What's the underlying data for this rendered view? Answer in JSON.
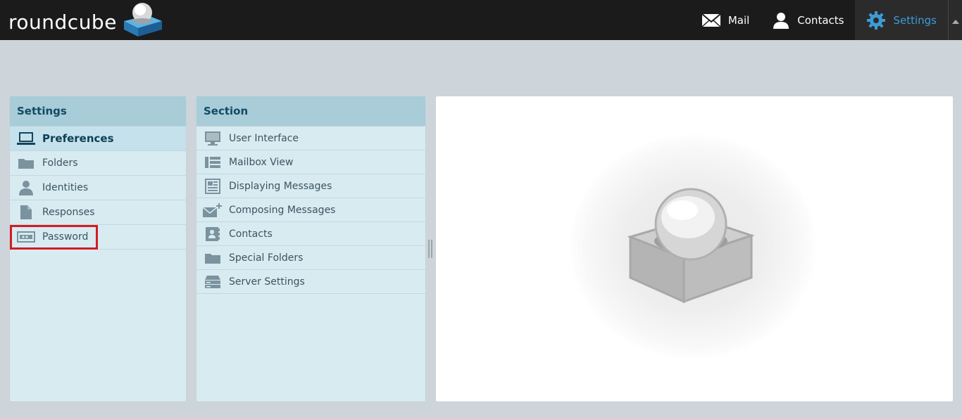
{
  "app": {
    "logo_text": "roundcube"
  },
  "topnav": [
    {
      "label": "Mail",
      "icon": "mail-icon"
    },
    {
      "label": "Contacts",
      "icon": "contacts-icon"
    },
    {
      "label": "Settings",
      "icon": "gear-icon",
      "active": true
    }
  ],
  "settings_panel": {
    "title": "Settings",
    "items": [
      {
        "label": "Preferences",
        "icon": "laptop-icon",
        "selected": true
      },
      {
        "label": "Folders",
        "icon": "folder-icon"
      },
      {
        "label": "Identities",
        "icon": "identity-icon"
      },
      {
        "label": "Responses",
        "icon": "document-icon"
      },
      {
        "label": "Password",
        "icon": "password-icon"
      }
    ]
  },
  "section_panel": {
    "title": "Section",
    "items": [
      {
        "label": "User Interface",
        "icon": "monitor-icon"
      },
      {
        "label": "Mailbox View",
        "icon": "list-view-icon"
      },
      {
        "label": "Displaying Messages",
        "icon": "message-view-icon"
      },
      {
        "label": "Composing Messages",
        "icon": "compose-mail-icon"
      },
      {
        "label": "Contacts",
        "icon": "address-book-icon"
      },
      {
        "label": "Special Folders",
        "icon": "folder-icon"
      },
      {
        "label": "Server Settings",
        "icon": "server-icon"
      }
    ]
  },
  "colors": {
    "topbar": "#1b1b1b",
    "accent": "#3d9bd8",
    "panel_header": "#a8ccd8",
    "panel_bg": "#d8ebf1",
    "highlight": "#d11c24"
  }
}
